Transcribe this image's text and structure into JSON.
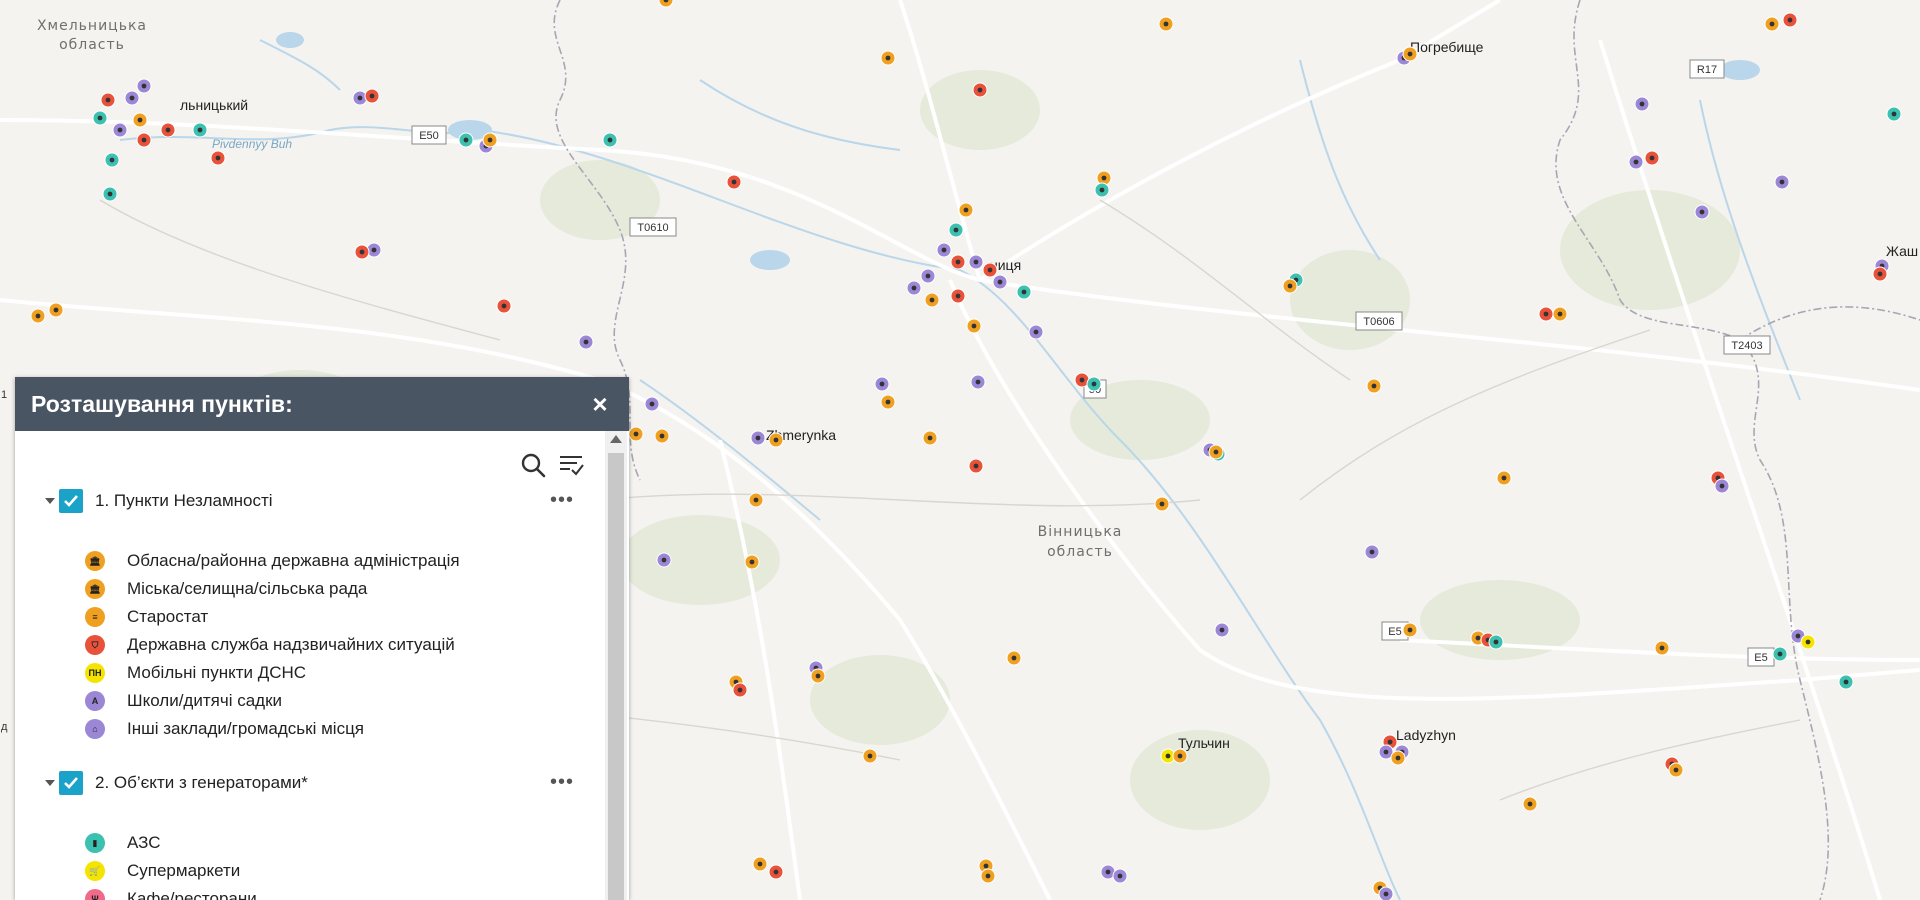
{
  "map": {
    "regions": [
      {
        "line1": "Хмельницька",
        "line2": "область"
      },
      {
        "line1": "Вінницька",
        "line2": "область"
      }
    ],
    "cities": {
      "khmelnytskyi": "льницький",
      "pohrebyshche": "Погребище",
      "vinnytsia": "ниця",
      "zhmerynka": "Zhmerynka",
      "tulchyn": "Тульчин",
      "ladyzhyn": "Ladyzhyn",
      "zhash": "Жаш",
      "river": "Pivdennyy Buh"
    },
    "roads": {
      "e50_a": "E50",
      "t0610": "T0610",
      "t0606": "T0606",
      "r17": "R17",
      "t2403": "T2403",
      "e50_b": "E5",
      "e50_c": "E5",
      "t0_partial": "50"
    },
    "edge_fragments": {
      "left_a": "1",
      "left_b": "д"
    },
    "colors": {
      "water": "#bcd7ea",
      "land": "#f4f3ef",
      "forest": "#e6ebdc",
      "border": "#a8a4b2",
      "road": "#ffffff"
    }
  },
  "panel": {
    "title": "Розташування пунктів:",
    "close": "×",
    "tools": {
      "search": "search-icon",
      "filter": "filter-list-icon"
    },
    "layers": [
      {
        "label": "1. Пункти Незламності",
        "more": "•••",
        "items": [
          {
            "label": "Обласна/районна державна адміністрація",
            "color": "#f0a020",
            "glyph": "🏛"
          },
          {
            "label": "Міська/селищна/сільська рада",
            "color": "#f0a020",
            "glyph": "🏛"
          },
          {
            "label": "Старостат",
            "color": "#f0a020",
            "glyph": "≡"
          },
          {
            "label": "Державна служба надзвичайних ситуацій",
            "color": "#e8523a",
            "glyph": "⛉"
          },
          {
            "label": "Мобільні пункти ДСНС",
            "color": "#f5e400",
            "glyph": "ПН"
          },
          {
            "label": "Школи/дитячі садки",
            "color": "#9b87d6",
            "glyph": "A"
          },
          {
            "label": "Інші заклади/громадські місця",
            "color": "#9b87d6",
            "glyph": "⌂"
          }
        ]
      },
      {
        "label": "2. Об’єкти з генераторами*",
        "more": "•••",
        "items": [
          {
            "label": "АЗС",
            "color": "#3cc0b0",
            "glyph": "▮"
          },
          {
            "label": "Супермаркети",
            "color": "#f5e400",
            "glyph": "🛒"
          },
          {
            "label": "Кафе/ресторани",
            "color": "#f06a8a",
            "glyph": "Ψ"
          }
        ]
      }
    ]
  }
}
